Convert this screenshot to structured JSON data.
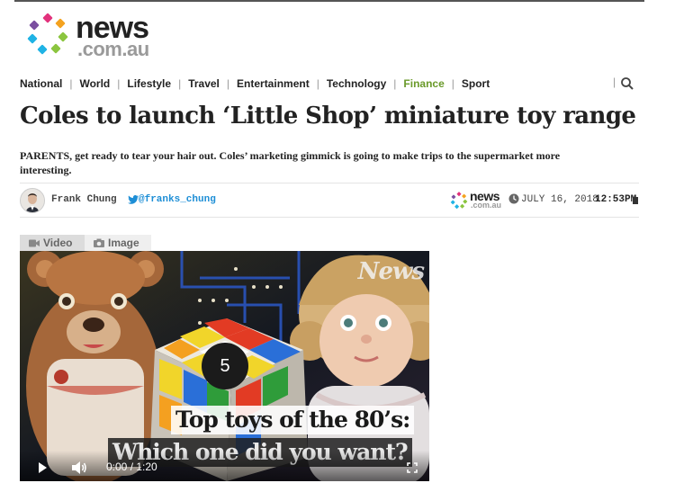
{
  "logo": {
    "news": "news",
    "domain": ".com.au"
  },
  "nav": {
    "items": [
      "National",
      "World",
      "Lifestyle",
      "Travel",
      "Entertainment",
      "Technology",
      "Finance",
      "Sport"
    ],
    "search_icon": "search-icon"
  },
  "article": {
    "headline": "Coles to launch ‘Little Shop’ miniature toy range",
    "standfirst": "PARENTS, get ready to tear your hair out. Coles’ marketing gimmick is going to make trips to the supermarket more interesting."
  },
  "byline": {
    "author": "Frank Chung",
    "twitter": "@franks_chung",
    "source_news": "news",
    "source_domain": ".com.au",
    "date": "JULY 16, 2018",
    "time": "12:53PM"
  },
  "media": {
    "tabs": [
      "Video",
      "Image"
    ],
    "active_tab": "Video"
  },
  "video": {
    "brand": "News",
    "countdown": "5",
    "caption_line1": "Top toys of the 80’s:",
    "caption_line2": "Which one did you want?",
    "current_time": "0:00",
    "duration": "1:20",
    "progress": 0
  },
  "colors": {
    "finance_accent": "#6a9a2a",
    "twitter": "#1d8ed6",
    "logo_dots": [
      "#e2327c",
      "#f4a21f",
      "#8bc53f",
      "#1fb3e5",
      "#7b4fa0",
      "#ef5a29"
    ]
  }
}
